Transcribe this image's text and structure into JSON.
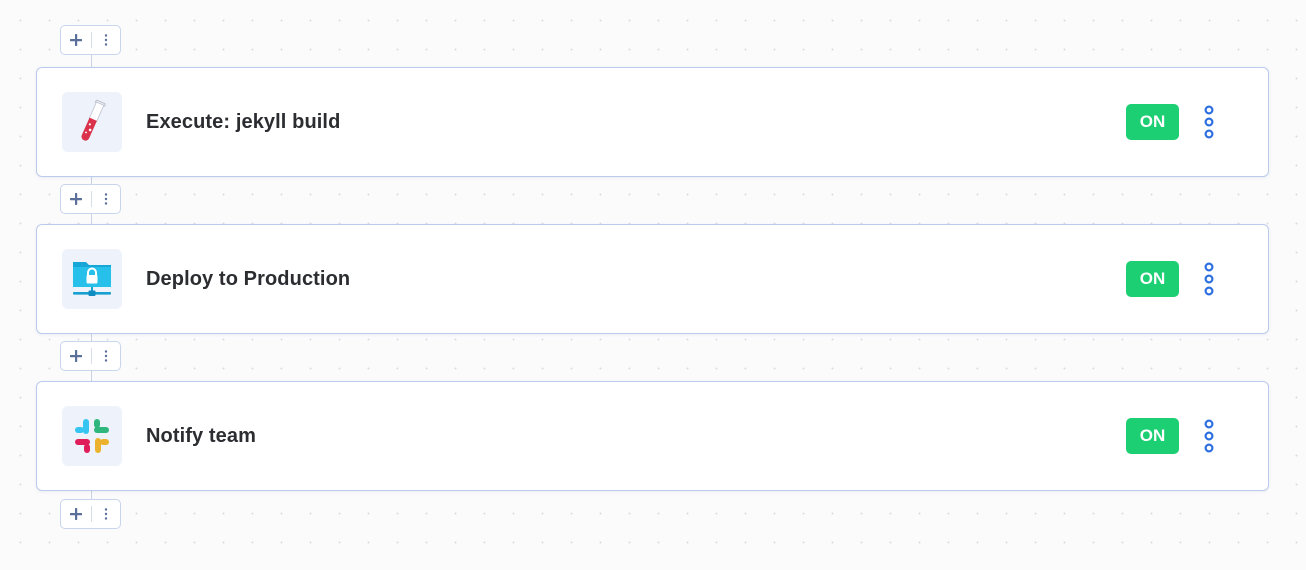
{
  "steps": [
    {
      "title": "Execute: jekyll build",
      "icon": "test-tube-icon",
      "status": "ON"
    },
    {
      "title": "Deploy to Production",
      "icon": "secure-server-folder-icon",
      "status": "ON"
    },
    {
      "title": "Notify team",
      "icon": "slack-icon",
      "status": "ON"
    }
  ],
  "colors": {
    "toggle_on": "#1dcf73",
    "kebab": "#2e6fe0",
    "card_border": "#bccbec",
    "add_button_border": "#c9d5ec",
    "add_icon": "#5a6f99",
    "icon_bg": "#edf2fb"
  }
}
